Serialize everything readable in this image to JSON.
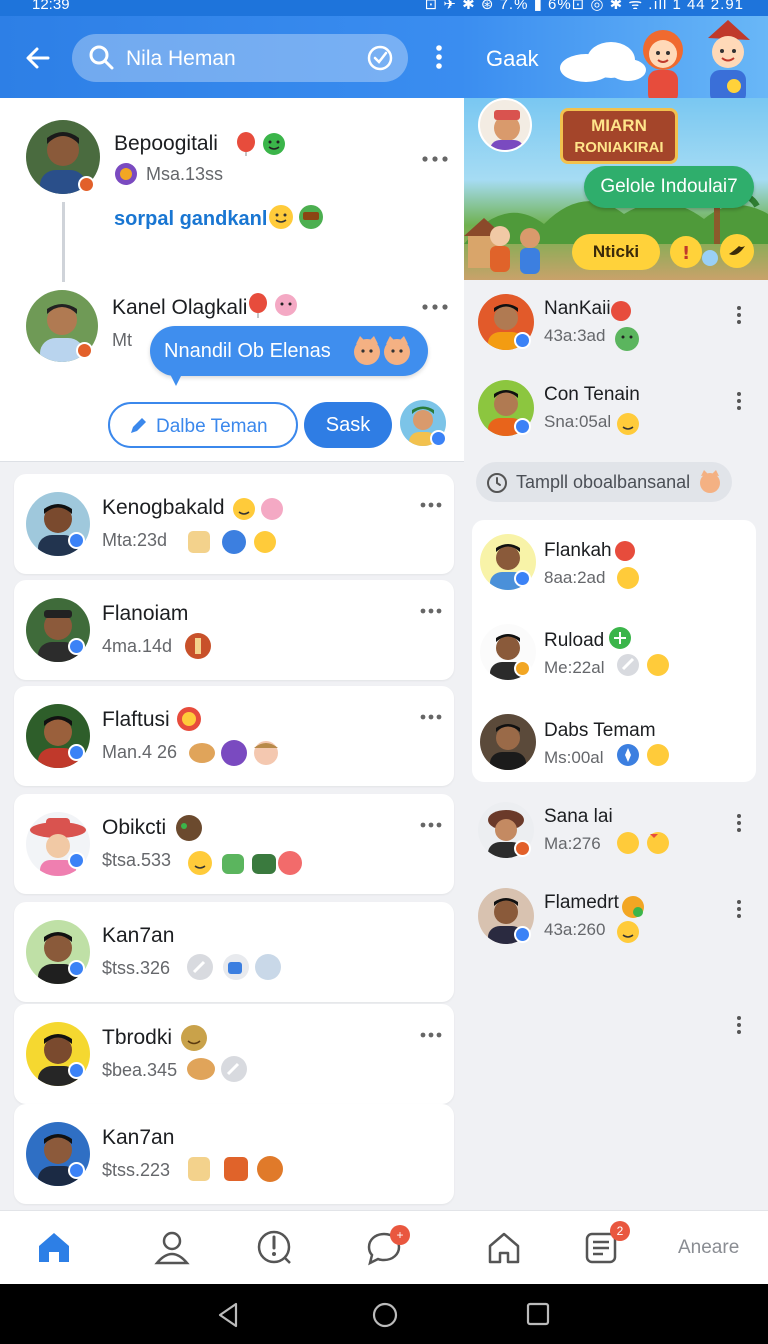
{
  "status_bar": {
    "time": "12:39",
    "right_text": "⊡ ✈ ✱ ⊛ 7.% ▮ 6%⊡ ◎ ✱ ᯤ .ıll 1 44 2.91"
  },
  "header": {
    "search_text": "Nila Heman",
    "right_label": "Gaak"
  },
  "featured": {
    "post1": {
      "name": "Bepoogitali",
      "meta": "Msa.13ss",
      "link_text": "sorpal gandkanl"
    },
    "post2": {
      "name": "Kanel Olagkali",
      "meta": "Mt",
      "bubble_text": "Nnandil Ob Elenas"
    },
    "edit_button_label": "Dalbe Teman",
    "send_button_label": "Sask"
  },
  "left_list": [
    {
      "name": "Kenogbakald",
      "meta": "Mta:23d"
    },
    {
      "name": "Flanoiam",
      "meta": "4ma.14d"
    },
    {
      "name": "Flaftusi",
      "meta": "Man.4 26"
    },
    {
      "name": "Obikcti",
      "meta": "$tsa.533"
    },
    {
      "name": "Kan7an",
      "meta": "$tss.326"
    },
    {
      "name": "Tbrodki",
      "meta": "$bea.345"
    },
    {
      "name": "Kan7an",
      "meta": "$tss.223"
    }
  ],
  "banner": {
    "title_line1": "MIARN",
    "title_line2": "RONIAKIRAI",
    "pill_text": "Gelole Indoulai7",
    "button_text": "Nticki"
  },
  "right_list_top": [
    {
      "name": "NanKaii",
      "meta": "43a:3ad"
    },
    {
      "name": "Con Tenain",
      "meta": "Sna:05al"
    }
  ],
  "chip_label": "Tampll oboalbansanal",
  "right_card": [
    {
      "name": "Flankah",
      "meta": "8aa:2ad"
    },
    {
      "name": "Ruload",
      "meta": "Me:22al"
    },
    {
      "name": "Dabs Temam",
      "meta": "Ms:00al"
    }
  ],
  "right_list_bottom": [
    {
      "name": "Sana lai",
      "meta": "Ma:276"
    },
    {
      "name": "Flamedrt",
      "meta": "43a:260"
    }
  ],
  "bottom_nav": {
    "chat_badge": "+",
    "news_badge": "2",
    "label": "Aneare"
  },
  "colors": {
    "primary": "#2d7fe6",
    "accent_green": "#2fae6c",
    "badge_red": "#e9573f"
  }
}
